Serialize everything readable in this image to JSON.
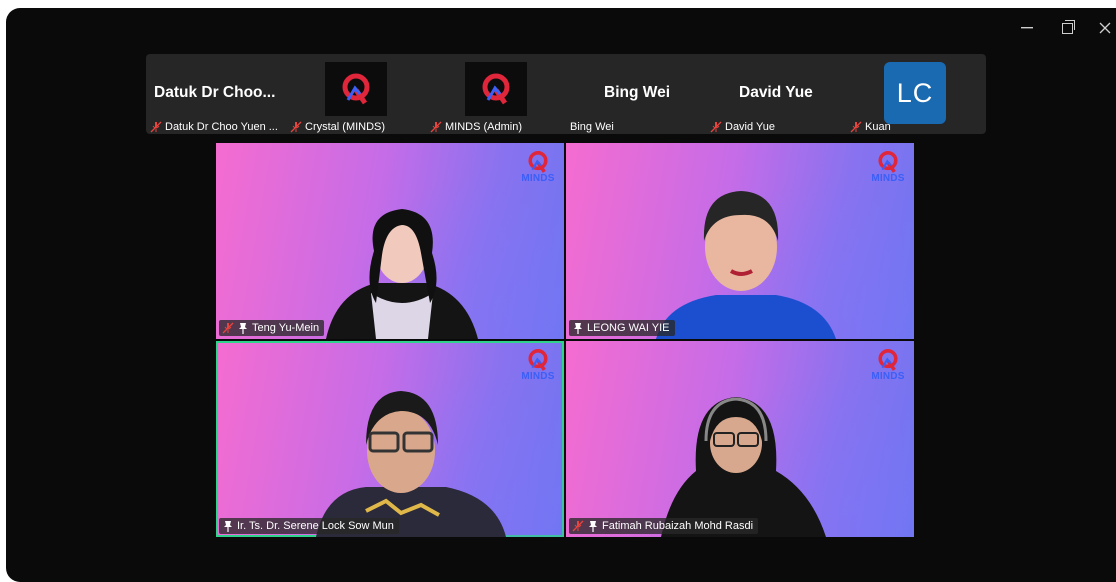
{
  "strip": {
    "tiles": [
      {
        "big_name": "Datuk Dr Choo...",
        "label": "Datuk Dr Choo Yuen ...",
        "muted": true
      },
      {
        "label": "Crystal (MINDS)",
        "muted": true
      },
      {
        "label": "MINDS (Admin)",
        "muted": true
      },
      {
        "big_name": "Bing Wei",
        "label": "Bing Wei",
        "muted": false
      },
      {
        "big_name": "David Yue",
        "label": "David Yue",
        "muted": true
      },
      {
        "avatar_text": "LC",
        "label": "Kuan",
        "muted": true
      }
    ]
  },
  "grid": {
    "tiles": [
      {
        "name": "Teng Yu-Mein",
        "muted": true,
        "pinned": true
      },
      {
        "name": "LEONG WAI YIE",
        "muted": false,
        "pinned": true
      },
      {
        "name": "Ir. Ts. Dr. Serene Lock Sow Mun",
        "muted": false,
        "pinned": true,
        "active": true
      },
      {
        "name": "Fatimah Rubaizah Mohd Rasdi",
        "muted": true,
        "pinned": true
      }
    ],
    "logo_text": "MINDS"
  },
  "colors": {
    "mute_red": "#e8443f",
    "active_border": "#2fd38b",
    "avatar_blue": "#1a6ab1",
    "logo_red": "#e0263a",
    "logo_blue": "#3b5ff7"
  },
  "icons": {
    "minimize": "minimize-icon",
    "maximize": "restore-icon",
    "close": "close-icon",
    "mute": "muted-mic-icon",
    "pin": "pin-icon"
  }
}
